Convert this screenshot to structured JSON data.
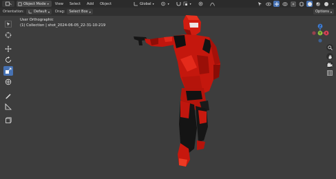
{
  "header": {
    "mode": "Object Mode",
    "menu": [
      "View",
      "Select",
      "Add",
      "Object"
    ],
    "transform_orientation": "Global"
  },
  "toolbar2": {
    "orientation_label": "Orientation:",
    "orientation_value": "Default",
    "drag_label": "Drag:",
    "drag_value": "Select Box",
    "options_label": "Options"
  },
  "viewport": {
    "view_name": "User Orthographic",
    "collection_info": "(1) Collection | shot_2024-06-05_22-31-10-219"
  },
  "gizmo": {
    "x_label": "X",
    "y_label": "Y",
    "z_label": "Z"
  },
  "colors": {
    "accent": "#4772b3",
    "x_axis": "#e4445b",
    "y_axis": "#8dc63f",
    "z_axis": "#3f7fd9",
    "viewport_bg": "#3d3d3d"
  }
}
